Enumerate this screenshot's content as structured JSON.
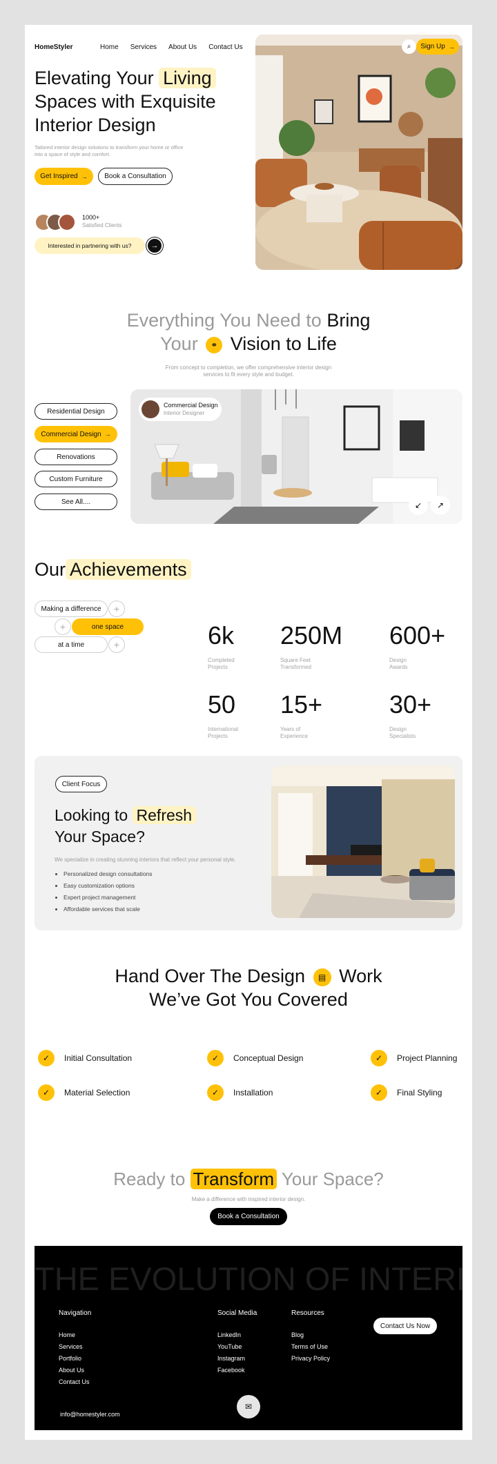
{
  "header": {
    "brand": "HomeStyler",
    "nav": [
      "Home",
      "Services",
      "About Us",
      "Contact Us"
    ],
    "signup": "Sign Up",
    "icons": {
      "search": "search-icon",
      "arrow": "arrow-right-icon"
    }
  },
  "hero": {
    "title_1": "Elevating Your",
    "title_hl": "Living",
    "title_2": "Spaces with Exquisite",
    "title_3": "Interior Design",
    "subtitle_1": "Tailored interior design solutions to transform your home or office",
    "subtitle_2": "into a space of style and comfort.",
    "cta_primary": "Get Inspired",
    "cta_secondary": "Book a Consultation",
    "clients_count": "1000+",
    "clients_label": "Satisfied Clients",
    "partner_text": "Interested in partnering with us?"
  },
  "services": {
    "title_a1": "Everything You Need to",
    "title_b1": "Bring",
    "title_a2": "Your",
    "title_b2": "Vision to Life",
    "desc_1": "From concept to completion, we offer comprehensive interior design",
    "desc_2": "services to fit every style and budget.",
    "items": [
      "Residential Design",
      "Commercial Design",
      "Renovations",
      "Custom Furniture",
      "See All...."
    ],
    "active_index": 1,
    "card_title": "Commercial Design",
    "card_role": "Interior Designer"
  },
  "achievements": {
    "title_a": "Our",
    "title_hl": "Achievements",
    "tags": [
      "Making a difference",
      "one space",
      "at a time"
    ],
    "stats": [
      {
        "value": "6k",
        "label_1": "Completed",
        "label_2": "Projects"
      },
      {
        "value": "250M",
        "label_1": "Square Feet",
        "label_2": "Transformed"
      },
      {
        "value": "600+",
        "label_1": "Design",
        "label_2": "Awards"
      },
      {
        "value": "50",
        "label_1": "International",
        "label_2": "Projects"
      },
      {
        "value": "15+",
        "label_1": "Years of",
        "label_2": "Experience"
      },
      {
        "value": "30+",
        "label_1": "Design",
        "label_2": "Specialists"
      }
    ]
  },
  "refresh": {
    "tag": "Client Focus",
    "title_1": "Looking to",
    "title_hl": "Refresh",
    "title_2": "Your Space?",
    "desc": "We specialize in creating stunning interiors that reflect your personal style.",
    "bullets": [
      "Personalized design consultations",
      "Easy customization options",
      "Expert project management",
      "Affordable services that scale"
    ]
  },
  "handover": {
    "title_1a": "Hand Over The Design",
    "title_1b": "Work",
    "title_2": "We’ve Got You Covered",
    "steps": [
      "Initial Consultation",
      "Conceptual Design",
      "Project Planning",
      "Material Selection",
      "Installation",
      "Final Styling"
    ]
  },
  "cta": {
    "title_a": "Ready to",
    "title_hl": "Transform",
    "title_b": "Your Space?",
    "subtitle": "Make a difference with inspired interior design.",
    "button": "Book a Consultation"
  },
  "footer": {
    "marquee": "THE EVOLUTION OF INTERI",
    "nav_title": "Navigation",
    "nav_links": [
      "Home",
      "Services",
      "Portfolio",
      "About Us",
      "Contact Us"
    ],
    "social_title": "Social Media",
    "social_links": [
      "LinkedIn",
      "YouTube",
      "Instagram",
      "Facebook"
    ],
    "res_title": "Resources",
    "res_links": [
      "Blog",
      "Terms of Use",
      "Privacy Policy"
    ],
    "contact_button": "Contact Us Now",
    "email": "info@homestyler.com"
  },
  "colors": {
    "accent": "#ffc107",
    "accent_soft": "#fff3c4",
    "dark": "#000000",
    "panel": "#f1f1f2"
  }
}
